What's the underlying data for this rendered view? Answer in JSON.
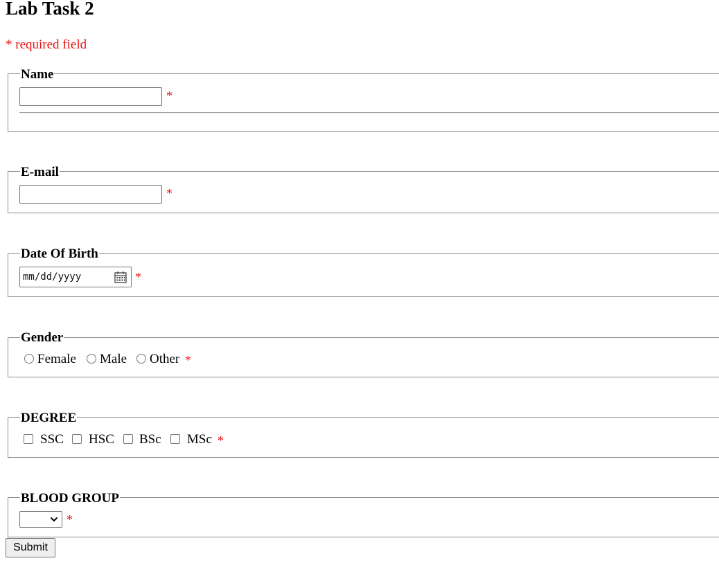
{
  "page": {
    "title": "Lab Task 2",
    "required_note": "* required field"
  },
  "required_marker": "*",
  "colors": {
    "required": "#ee1111",
    "border": "#8a8a8a"
  },
  "fieldsets": {
    "name": {
      "legend": "Name",
      "value": ""
    },
    "email": {
      "legend": "E-mail",
      "value": ""
    },
    "dob": {
      "legend": "Date Of Birth",
      "placeholder": "mm/dd/yyyy",
      "icon": "calendar-icon"
    },
    "gender": {
      "legend": "Gender",
      "options": [
        "Female",
        "Male",
        "Other"
      ],
      "selected": ""
    },
    "degree": {
      "legend": "DEGREE",
      "options": [
        "SSC",
        "HSC",
        "BSc",
        "MSc"
      ],
      "checked": []
    },
    "blood_group": {
      "legend": "BLOOD GROUP",
      "selected": "",
      "icon": "chevron-down-icon"
    }
  },
  "submit_label": "Submit"
}
